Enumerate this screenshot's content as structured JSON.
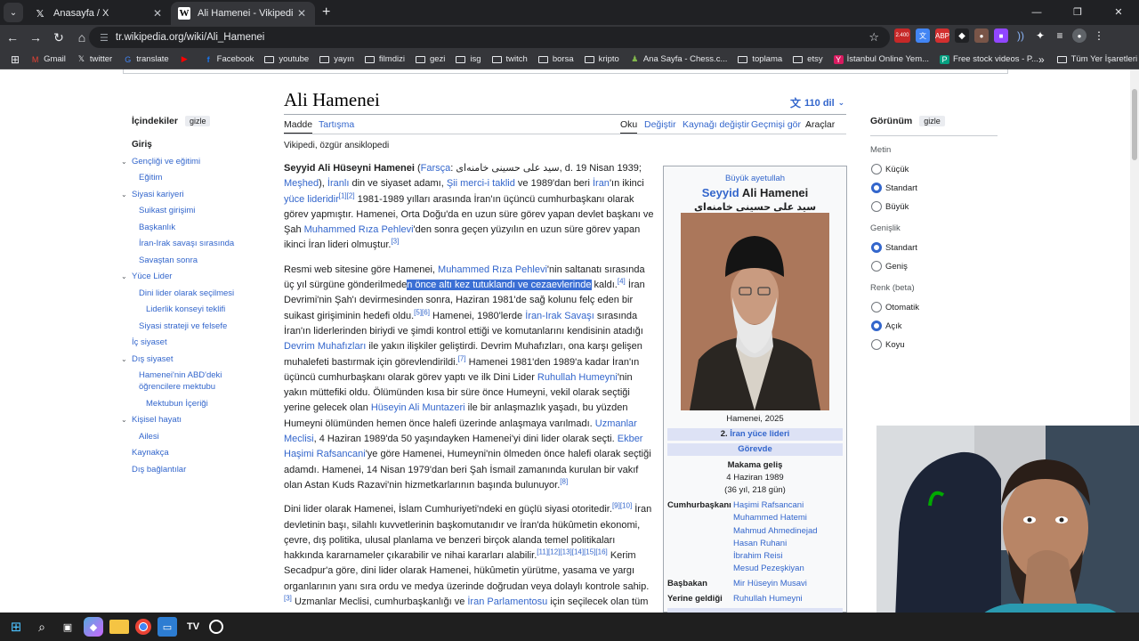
{
  "browser": {
    "tabs": [
      {
        "title": "Anasayfa / X",
        "icon": "x-logo"
      },
      {
        "title": "Ali Hamenei - Vikipedi",
        "icon": "wikipedia-logo"
      }
    ],
    "url": "tr.wikipedia.org/wiki/Ali_Hamenei",
    "notif_badge": "2.400",
    "bookmarks": [
      "Gmail",
      "twitter",
      "translate",
      "Facebook",
      "youtube",
      "yayın",
      "filmdizi",
      "gezi",
      "isg",
      "twitch",
      "borsa",
      "kripto",
      "Ana Sayfa - Chess.c...",
      "toplama",
      "etsy",
      "İstanbul Online Yem...",
      "Free stock videos - P..."
    ],
    "bookmarks_more": "»",
    "all_bookmarks": "Tüm Yer İşaretleri"
  },
  "wiki": {
    "title": "Ali Hamenei",
    "languages": "110 dil",
    "toc": {
      "heading": "İçindekiler",
      "hide": "gizle",
      "items": [
        {
          "label": "Giriş",
          "level": 0,
          "top": true
        },
        {
          "label": "Gençliği ve eğitimi",
          "level": 0,
          "chev": true
        },
        {
          "label": "Eğitim",
          "level": 1
        },
        {
          "label": "Siyasi kariyeri",
          "level": 0,
          "chev": true
        },
        {
          "label": "Suikast girişimi",
          "level": 1
        },
        {
          "label": "Başkanlık",
          "level": 1
        },
        {
          "label": "İran-Irak savaşı sırasında",
          "level": 1
        },
        {
          "label": "Savaştan sonra",
          "level": 1
        },
        {
          "label": "Yüce Lider",
          "level": 0,
          "chev": true
        },
        {
          "label": "Dini lider olarak seçilmesi",
          "level": 1
        },
        {
          "label": "Liderlik konseyi teklifi",
          "level": 2
        },
        {
          "label": "Siyasi strateji ve felsefe",
          "level": 1
        },
        {
          "label": "İç siyaset",
          "level": 0
        },
        {
          "label": "Dış siyaset",
          "level": 0,
          "chev": true
        },
        {
          "label": "Hamenei'nin ABD'deki öğrencilere mektubu",
          "level": 1
        },
        {
          "label": "Mektubun İçeriği",
          "level": 2
        },
        {
          "label": "Kişisel hayatı",
          "level": 0,
          "chev": true
        },
        {
          "label": "Ailesi",
          "level": 1
        },
        {
          "label": "Kaynakça",
          "level": 0
        },
        {
          "label": "Dış bağlantılar",
          "level": 0
        }
      ]
    },
    "tabs": {
      "article": "Madde",
      "talk": "Tartışma",
      "read": "Oku",
      "edit": "Değiştir",
      "edit_source": "Kaynağı değiştir",
      "history": "Geçmişi gör",
      "tools": "Araçlar"
    },
    "tagline": "Vikipedi, özgür ansiklopedi",
    "para1": {
      "bold": "Seyyid Ali Hüseyni Hamenei",
      "open": " (",
      "farsi_link": "Farsça",
      "farsi_text": ": سید علی حسینی خامنه‌ای, d. 19 Nisan 1939; ",
      "meshed": "Meşhed",
      "t1": "), ",
      "iranli": "İranlı",
      "t2": " din ve siyaset adamı, ",
      "sii": "Şii merci-i taklid",
      "t3": " ve 1989'dan beri ",
      "iran": "İran",
      "t4": "'ın ikinci ",
      "yuce": "yüce lideridir",
      "ref1": "[1][2]",
      "t5": " 1981-1989 yılları arasında İran'ın üçüncü cumhurbaşkanı olarak görev yapmıştır. Hamenei, Orta Doğu'da en uzun süre görev yapan devlet başkanı ve Şah ",
      "pehlevi": "Muhammed Rıza Pehlevi",
      "t6": "'den sonra geçen yüzyılın en uzun süre görev yapan ikinci İran lideri olmuştur.",
      "ref2": "[3]"
    },
    "para2": {
      "t1": "Resmi web sitesine göre Hamenei, ",
      "pehlevi": "Muhammed Rıza Pehlevi",
      "t2": "'nin saltanatı sırasında üç yıl sürgüne gönderilmede",
      "selected": "n önce altı kez tutuklandı ve cezaevlerinde",
      "t3": " kaldı.",
      "ref3": "[4]",
      "t4": " İran Devrimi'nin Şah'ı devirmesinden sonra, Haziran 1981'de sağ kolunu felç eden bir suikast girişiminin hedefi oldu.",
      "ref4": "[5][6]",
      "t5": " Hamenei, 1980'lerde ",
      "iraniraq": "İran-Irak Savaşı",
      "t6": " sırasında İran'ın liderlerinden biriydi ve şimdi kontrol ettiği ve komutanlarını kendisinin atadığı ",
      "devrim": "Devrim Muhafızları",
      "t7": " ile yakın ilişkiler geliştirdi. Devrim Muhafızları, ona karşı gelişen muhalefeti bastırmak için görevlendirildi.",
      "ref5": "[7]",
      "t8": " Hamenei 1981'den 1989'a kadar İran'ın üçüncü cumhurbaşkanı olarak görev yaptı ve ilk Dini Lider ",
      "humeyni": "Ruhullah Humeyni",
      "t9": "'nin yakın müttefiki oldu. Ölümünden kısa bir süre önce Humeyni, vekil olarak seçtiği yerine gelecek olan ",
      "muntazeri": "Hüseyin Ali Muntazeri",
      "t10": " ile bir anlaşmazlık yaşadı, bu yüzden Humeyni ölümünden hemen önce halefi üzerinde anlaşmaya varılmadı. ",
      "uzmanlar": "Uzmanlar Meclisi",
      "t11": ", 4 Haziran 1989'da 50 yaşındayken Hamenei'yi dini lider olarak seçti. ",
      "rafsancani": "Ekber Haşimi Rafsancani",
      "t12": "'ye göre Hamenei, Humeyni'nin ölmeden önce halefi olarak seçtiği adamdı. Hamenei, 14 Nisan 1979'dan beri Şah İsmail zamanında kurulan bir vakıf olan Astan Kuds Razavi'nin hizmetkarlarının başında bulunuyor.",
      "ref6": "[8]"
    },
    "para3": {
      "t1": "Dini lider olarak Hamenei, İslam Cumhuriyeti'ndeki en güçlü siyasi otoritedir.",
      "ref7": "[9][10]",
      "t2": " İran devletinin başı, silahlı kuvvetlerinin başkomutanıdır ve İran'da hükûmetin ekonomi, çevre, dış politika, ulusal planlama ve benzeri birçok alanda temel politikaları hakkında kararnameler çıkarabilir ve nihai kararları alabilir.",
      "ref8": "[11][12][13][14][15][16]",
      "t3": " Kerim Secadpur'a göre, dini lider olarak Hamenei, hükûmetin yürütme, yasama ve yargı organlarının yanı sıra ordu ve medya üzerinde doğrudan veya dolaylı kontrole sahip.",
      "ref9": "[3]",
      "t4": " Uzmanlar Meclisi, cumhurbaşkanlığı ve ",
      "parlamento": "İran Parlamentosu",
      "t5": " için seçilecek olan tüm adayların başvuruları,"
    },
    "infobox": {
      "subtitle": "Büyük ayetullah",
      "name_prefix": "Seyyid",
      "name": " Ali Hamenei",
      "arabic": "سید علی حسینی خامنه‌ای",
      "caption": "Hamenei, 2025",
      "office_no": "2. ",
      "office": "İran yüce lideri",
      "gorevde": "Görevde",
      "makama_label": "Makama geliş",
      "makama_date": "4 Haziran 1989",
      "makama_dur": "(36 yıl, 218 gün)",
      "cb_label": "Cumhurbaşkanı",
      "cb": [
        "Haşimi Rafsancani",
        "Muhammed Hatemi",
        "Mahmud Ahmedinejad",
        "Hasan Ruhani",
        "İbrahim Reisi",
        "Mesud Pezeşkiyan"
      ],
      "bb_label": "Başbakan",
      "bb": "Mir Hüseyin Musavi",
      "yg_label": "Yerine geldiği",
      "yg": "Ruhullah Humeyni"
    },
    "appearance": {
      "heading": "Görünüm",
      "hide": "gizle",
      "text_label": "Metin",
      "text_opts": [
        "Küçük",
        "Standart",
        "Büyük"
      ],
      "text_sel": 1,
      "width_label": "Genişlik",
      "width_opts": [
        "Standart",
        "Geniş"
      ],
      "width_sel": 0,
      "color_label": "Renk (beta)",
      "color_opts": [
        "Otomatik",
        "Açık",
        "Koyu"
      ],
      "color_sel": 1
    }
  }
}
